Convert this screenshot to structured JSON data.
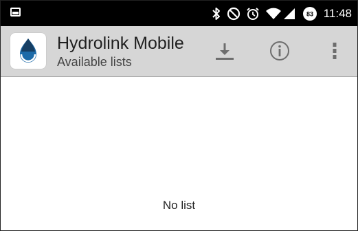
{
  "status_bar": {
    "time": "11:48",
    "battery_level": "83",
    "icons": [
      "gallery-icon",
      "bluetooth-icon",
      "do-not-disturb-icon",
      "alarm-icon",
      "wifi-icon",
      "signal-icon",
      "battery-icon"
    ]
  },
  "action_bar": {
    "title": "Hydrolink Mobile",
    "subtitle": "Available lists",
    "actions": [
      "download-icon",
      "info-icon",
      "overflow-menu-icon"
    ]
  },
  "content": {
    "empty_message": "No list"
  },
  "colors": {
    "status_bar_bg": "#000000",
    "action_bar_bg": "#d6d6d6",
    "icon_gray": "#6d6d6d",
    "logo_blue": "#1c6aa8",
    "logo_navy": "#163e63"
  }
}
